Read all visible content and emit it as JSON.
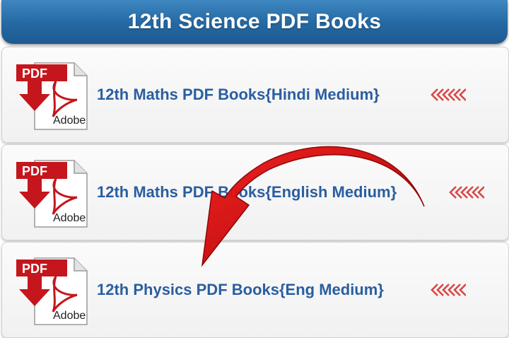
{
  "header": {
    "title": "12th Science PDF Books"
  },
  "pdf_icon": {
    "badge": "PDF",
    "brand": "Adobe"
  },
  "items": [
    {
      "label": "12th Maths PDF Books{Hindi Medium}"
    },
    {
      "label": "12th Maths PDF Books{English Medium}"
    },
    {
      "label": "12th Physics PDF Books{Eng Medium}"
    }
  ],
  "colors": {
    "header": "#2468a3",
    "link": "#2a5ea0",
    "pdf_red": "#c4161c",
    "arrow_red": "#d40000"
  },
  "icons": {
    "file": "pdf-file-icon",
    "pointer": "chevron-left-arrow-icon",
    "overlay": "curved-red-arrow-icon"
  }
}
